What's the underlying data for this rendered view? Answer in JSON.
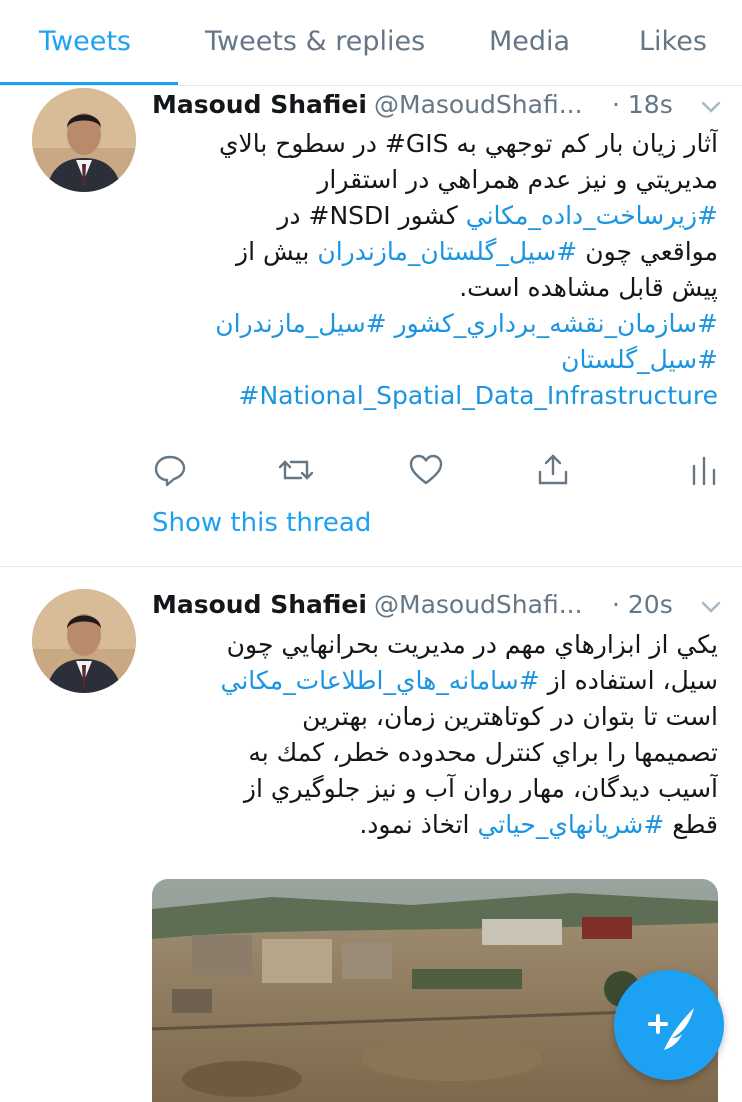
{
  "tabs": [
    {
      "label": "Tweets",
      "active": true
    },
    {
      "label": "Tweets & replies",
      "active": false
    },
    {
      "label": "Media",
      "active": false
    },
    {
      "label": "Likes",
      "active": false
    }
  ],
  "tweets": [
    {
      "name": "Masoud Shafiei",
      "handle": "@MasoudShafi...",
      "time": "· 18s",
      "lines": [
        [
          {
            "t": "آثار زيان بار كم توجهي به GIS# در سطوح بالاي"
          }
        ],
        [
          {
            "t": "مديريتي و نيز عدم همراهي در استقرار"
          }
        ],
        [
          {
            "t": "#زيرساخت_داده_مكاني",
            "h": true
          },
          {
            "t": " كشور NSDI# در"
          }
        ],
        [
          {
            "t": "مواقعي چون "
          },
          {
            "t": "#سيل_گلستان_مازندران",
            "h": true
          },
          {
            "t": " بيش از"
          }
        ],
        [
          {
            "t": "پيش قابل مشاهده است."
          }
        ],
        [
          {
            "t": "#سازمان_نقشه_برداري_كشور #سيل_مازندران",
            "h": true
          }
        ],
        [
          {
            "t": "#سيل_گلستان",
            "h": true
          }
        ],
        [
          {
            "t": "#National_Spatial_Data_Infrastructure",
            "h": true,
            "ltr": true
          }
        ]
      ],
      "thread_link": "Show this thread"
    },
    {
      "name": "Masoud Shafiei",
      "handle": "@MasoudShafi...",
      "time": "· 20s",
      "lines": [
        [
          {
            "t": "يكي از ابزارهاي مهم در مديريت بحرانهايي چون"
          }
        ],
        [
          {
            "t": "سيل، استفاده از "
          },
          {
            "t": "#سامانه_هاي_اطلاعات_مكاني",
            "h": true
          }
        ],
        [
          {
            "t": "است تا بتوان در كوتاهترين زمان، بهترين"
          }
        ],
        [
          {
            "t": "تصميمها را براي كنترل محدوده خطر، كمك به"
          }
        ],
        [
          {
            "t": "آسيب ديدگان، مهار روان آب و نيز جلوگيري از"
          }
        ],
        [
          {
            "t": "قطع "
          },
          {
            "t": "#شريانهاي_حياتي",
            "h": true
          },
          {
            "t": " اتخاذ نمود."
          }
        ]
      ]
    }
  ],
  "colors": {
    "accent": "#1da1f2",
    "hashtag": "#1b95e0",
    "muted": "#657786"
  },
  "icons": [
    "reply-icon",
    "retweet-icon",
    "like-icon",
    "share-icon",
    "analytics-icon",
    "chevron-down-icon",
    "compose-tweet-icon"
  ]
}
